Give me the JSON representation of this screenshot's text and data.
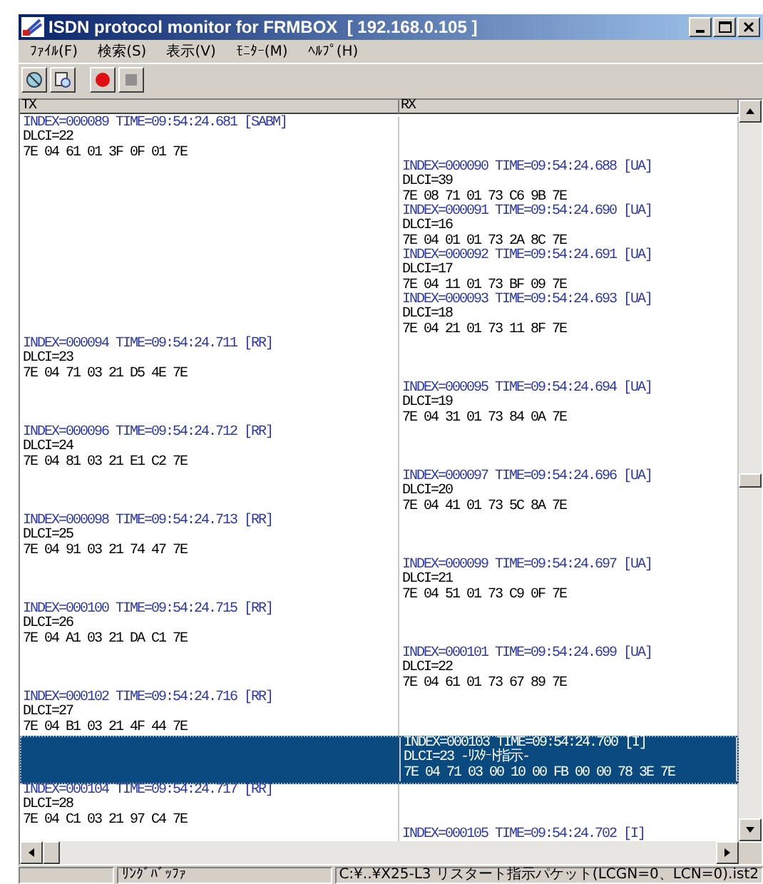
{
  "window": {
    "title": "ISDN protocol monitor for FRMBOX  [ 192.168.0.105 ]"
  },
  "menu": [
    "ﾌｧｲﾙ(F)",
    "検索(S)",
    "表示(V)",
    "ﾓﾆﾀｰ(M)",
    "ﾍﾙﾌﾟ(H)"
  ],
  "columns": [
    "TX",
    "RX"
  ],
  "records": [
    {
      "tx": {
        "header": "INDEX=000089 TIME=09:54:24.681 [SABM]",
        "lines": [
          "DLCI=22",
          "7E 04 61 01 3F 0F 01 7E"
        ]
      },
      "selected": false
    },
    {
      "rx": {
        "header": "INDEX=000090 TIME=09:54:24.688 [UA]",
        "lines": [
          "DLCI=39",
          "7E 08 71 01 73 C6 9B 7E"
        ]
      },
      "selected": false
    },
    {
      "rx": {
        "header": "INDEX=000091 TIME=09:54:24.690 [UA]",
        "lines": [
          "DLCI=16",
          "7E 04 01 01 73 2A 8C 7E"
        ]
      },
      "selected": false
    },
    {
      "rx": {
        "header": "INDEX=000092 TIME=09:54:24.691 [UA]",
        "lines": [
          "DLCI=17",
          "7E 04 11 01 73 BF 09 7E"
        ]
      },
      "selected": false
    },
    {
      "rx": {
        "header": "INDEX=000093 TIME=09:54:24.693 [UA]",
        "lines": [
          "DLCI=18",
          "7E 04 21 01 73 11 8F 7E"
        ]
      },
      "selected": false
    },
    {
      "tx": {
        "header": "INDEX=000094 TIME=09:54:24.711 [RR]",
        "lines": [
          "DLCI=23",
          "7E 04 71 03 21 D5 4E 7E"
        ]
      },
      "selected": false
    },
    {
      "rx": {
        "header": "INDEX=000095 TIME=09:54:24.694 [UA]",
        "lines": [
          "DLCI=19",
          "7E 04 31 01 73 84 0A 7E"
        ]
      },
      "selected": false
    },
    {
      "tx": {
        "header": "INDEX=000096 TIME=09:54:24.712 [RR]",
        "lines": [
          "DLCI=24",
          "7E 04 81 03 21 E1 C2 7E"
        ]
      },
      "selected": false
    },
    {
      "rx": {
        "header": "INDEX=000097 TIME=09:54:24.696 [UA]",
        "lines": [
          "DLCI=20",
          "7E 04 41 01 73 5C 8A 7E"
        ]
      },
      "selected": false
    },
    {
      "tx": {
        "header": "INDEX=000098 TIME=09:54:24.713 [RR]",
        "lines": [
          "DLCI=25",
          "7E 04 91 03 21 74 47 7E"
        ]
      },
      "selected": false
    },
    {
      "rx": {
        "header": "INDEX=000099 TIME=09:54:24.697 [UA]",
        "lines": [
          "DLCI=21",
          "7E 04 51 01 73 C9 0F 7E"
        ]
      },
      "selected": false
    },
    {
      "tx": {
        "header": "INDEX=000100 TIME=09:54:24.715 [RR]",
        "lines": [
          "DLCI=26",
          "7E 04 A1 03 21 DA C1 7E"
        ]
      },
      "selected": false
    },
    {
      "rx": {
        "header": "INDEX=000101 TIME=09:54:24.699 [UA]",
        "lines": [
          "DLCI=22",
          "7E 04 61 01 73 67 89 7E"
        ]
      },
      "selected": false
    },
    {
      "tx": {
        "header": "INDEX=000102 TIME=09:54:24.716 [RR]",
        "lines": [
          "DLCI=27",
          "7E 04 B1 03 21 4F 44 7E"
        ]
      },
      "selected": false
    },
    {
      "rx": {
        "header": "INDEX=000103 TIME=09:54:24.700 [I]",
        "lines": [
          "DLCI=23 -ﾘｽﾀｰﾄ指示-",
          "7E 04 71 03 00 10 00 FB 00 00 78 3E 7E"
        ]
      },
      "selected": true
    },
    {
      "tx": {
        "header": "INDEX=000104 TIME=09:54:24.717 [RR]",
        "lines": [
          "DLCI=28",
          "7E 04 C1 03 21 97 C4 7E"
        ]
      },
      "selected": false
    },
    {
      "rx": {
        "header": "INDEX=000105 TIME=09:54:24.702 [I]"
      },
      "selected": false
    }
  ],
  "status_bar": [
    "ﾘﾝｸﾞﾊﾞｯﾌｧ",
    "C:¥..¥X25-L3 リスタート指示パケット(LCGN=0、LCN=0).ist2"
  ]
}
